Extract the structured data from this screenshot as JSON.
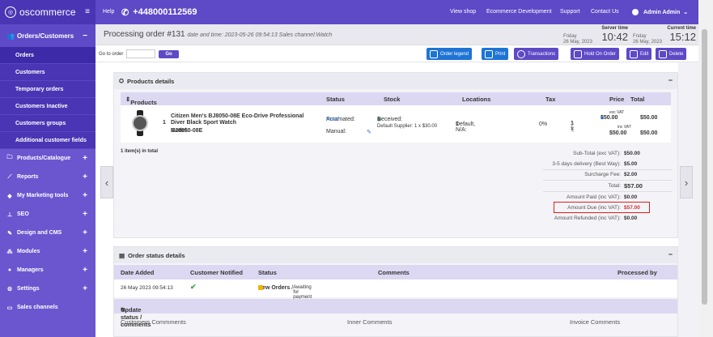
{
  "topbar": {
    "logo_text": "oscommerce",
    "help": "Help",
    "phone": "+448000112569",
    "links": [
      "View shop",
      "Ecommerce Development",
      "Support",
      "Contact Us"
    ],
    "admin": "Admin Admin"
  },
  "sidebar": {
    "section_title": "Orders/Customers",
    "section_toggle": "−",
    "subitems": [
      "Orders",
      "Customers",
      "Temporary orders",
      "Customers Inactive",
      "Customers groups",
      "Additional customer fields"
    ],
    "items": [
      {
        "label": "Products/Catalogue",
        "icon": "folder-icon"
      },
      {
        "label": "Reports",
        "icon": "chart-icon"
      },
      {
        "label": "My Marketing tools",
        "icon": "diamond-icon"
      },
      {
        "label": "SEO",
        "icon": "sitemap-icon"
      },
      {
        "label": "Design and CMS",
        "icon": "brush-icon"
      },
      {
        "label": "Modules",
        "icon": "puzzle-icon"
      },
      {
        "label": "Managers",
        "icon": "user-icon"
      },
      {
        "label": "Settings",
        "icon": "gear-icon"
      },
      {
        "label": "Sales channels",
        "icon": "monitor-icon"
      }
    ],
    "plus": "+"
  },
  "header": {
    "title": "Processing order #131",
    "meta": "date and time: 2023-05-26 09:54:13  Sales channel:Watch",
    "server_label": "Server time",
    "server_day": "Friday",
    "server_date": "26 May, 2023",
    "server_time": "10:42",
    "current_label": "Current time",
    "current_day": "Friday",
    "current_date": "26 May, 2023",
    "current_time": "15:12"
  },
  "toolbar": {
    "goto_label": "Go to order",
    "goto_placeholder": "",
    "go_button": "Go",
    "buttons": [
      "Order legend",
      "Print",
      "Transactions",
      "Hold On Order",
      "Edit",
      "Delete"
    ]
  },
  "products": {
    "panel_title": "Products details",
    "columns": [
      "Products",
      "Status",
      "Stock",
      "Locations",
      "Tax",
      "Price",
      "Total"
    ],
    "row": {
      "qty": "1",
      "name": "Citizen Men's BJ8050-08E Eco-Drive Professional Diver Black Sport Watch",
      "model_label": "Model:",
      "model": "BJ8050-08E",
      "status_auto_label": "Automated:",
      "status_auto": "Rcvd",
      "status_manual": "Manual:",
      "stock_received_label": "Received:",
      "stock_received": "1",
      "stock_supplier": "Default Supplier: 1 x $30.00",
      "location": "Default, N/A:",
      "location_qty": "1",
      "tax": "0%",
      "qty_sign": "1 ×",
      "price_exc_label": "exc VAT",
      "price_exc": "$50.00",
      "price_inc_label": "inc VAT",
      "price_inc": "$50.00",
      "total_exc": "$50.00",
      "total_inc": "$50.00"
    },
    "items_total": "1 item(s) in total",
    "totals": [
      {
        "label": "Sub-Total (exc VAT):",
        "value": "$50.00"
      },
      {
        "label": "3-5 days delivery (Best Way):",
        "value": "$5.00"
      },
      {
        "label": "Surcharge Fee:",
        "value": "$2.00"
      },
      {
        "label": "Total:",
        "value": "$57.00"
      },
      {
        "label": "Amount Paid (inc VAT):",
        "value": "$0.00"
      },
      {
        "label": "Amount Due (inc VAT):",
        "value": "$57.00"
      },
      {
        "label": "Amount Refunded (inc VAT):",
        "value": "$0.00"
      }
    ],
    "collapse": "−"
  },
  "status": {
    "panel_title": "Order status details",
    "columns": [
      "Date Added",
      "Customer Notified",
      "Status",
      "Comments",
      "Processed by"
    ],
    "row": {
      "date": "26 May 2023 09:54:13",
      "status_main": "New Orders",
      "status_sub": "Awaiting for payment"
    },
    "update_title": "Update status / comments",
    "comment_cols": [
      "Customers Commments",
      "Inner Comments",
      "Invoice Comments"
    ],
    "collapse": "−"
  },
  "colors": {
    "accent": "#5e49c6",
    "highlight": "#e51b1b",
    "button_blue": "#1e74d4"
  }
}
